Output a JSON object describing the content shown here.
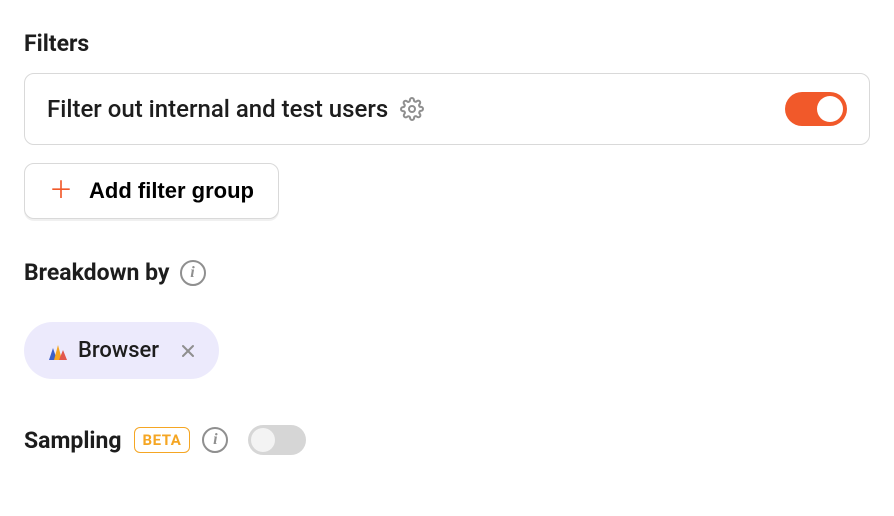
{
  "filters": {
    "heading": "Filters",
    "internal_test_users": {
      "label": "Filter out internal and test users",
      "enabled": true
    },
    "add_group_label": "Add filter group"
  },
  "breakdown": {
    "heading": "Breakdown by",
    "chip": {
      "label": "Browser"
    }
  },
  "sampling": {
    "heading": "Sampling",
    "badge": "BETA",
    "enabled": false
  }
}
